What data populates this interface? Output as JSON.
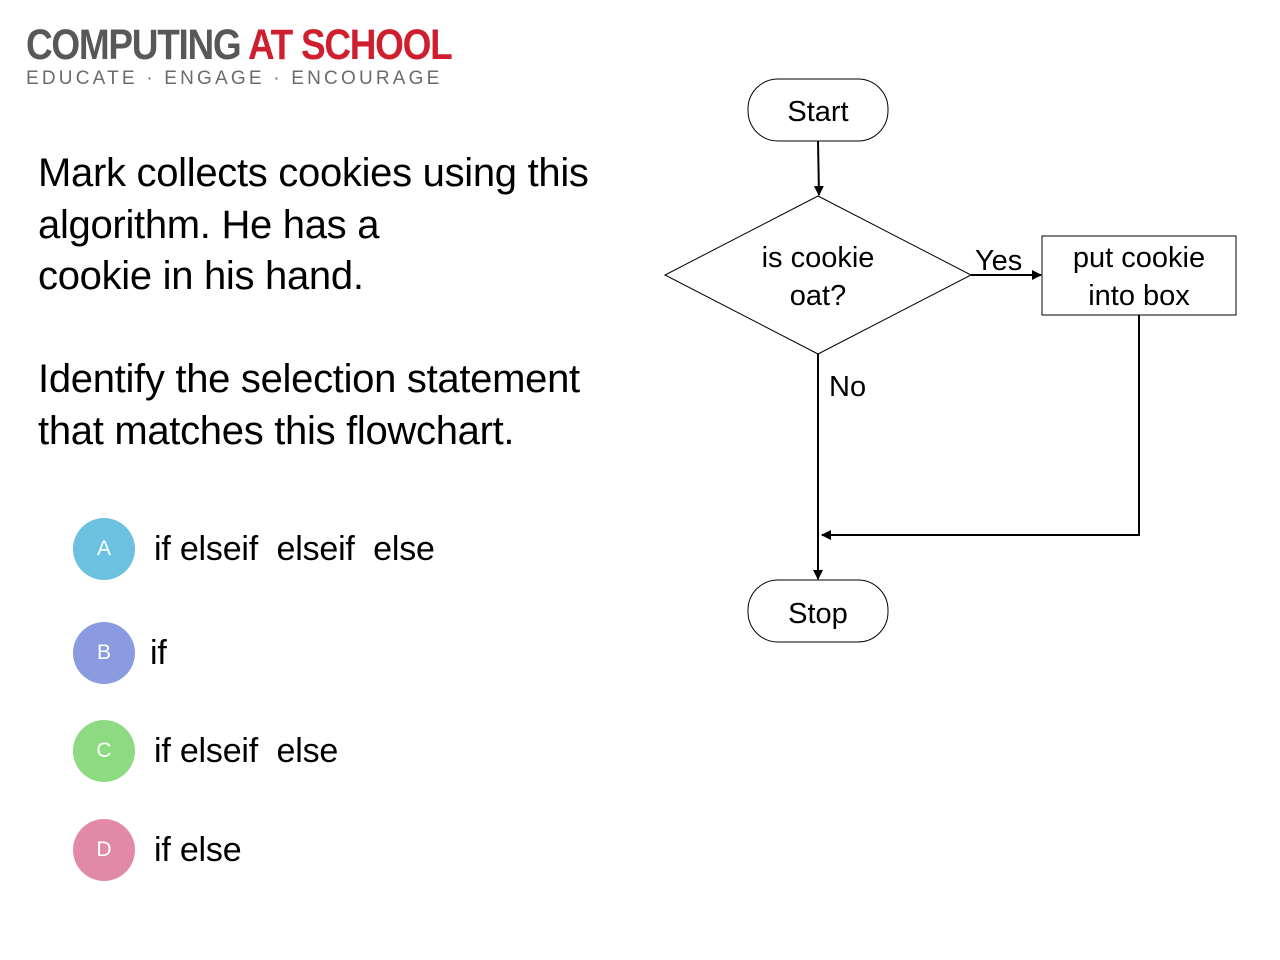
{
  "logo": {
    "part1": "COMPUTING",
    "part2": "AT SCHOOL",
    "tagline": "EDUCATE · ENGAGE · ENCOURAGE",
    "colors": {
      "grey": "#58585a",
      "red": "#cf1f2e"
    }
  },
  "question": {
    "text": "Mark collects cookies using this\nalgorithm.  He has a\ncookie in his hand.\n\nIdentify the selection statement\nthat matches this flowchart."
  },
  "options": [
    {
      "letter": "A",
      "text": "if elseif  elseif  else",
      "color": "#6cc0e0"
    },
    {
      "letter": "B",
      "text": "if",
      "color": "#8b9be0"
    },
    {
      "letter": "C",
      "text": "if elseif  else",
      "color": "#8ddb80"
    },
    {
      "letter": "D",
      "text": "if else",
      "color": "#e389a8"
    }
  ],
  "flowchart": {
    "start": "Start",
    "decision_line1": "is cookie",
    "decision_line2": "oat?",
    "yes_label": "Yes",
    "no_label": "No",
    "process_line1": "put cookie",
    "process_line2": "into box",
    "stop": "Stop"
  }
}
